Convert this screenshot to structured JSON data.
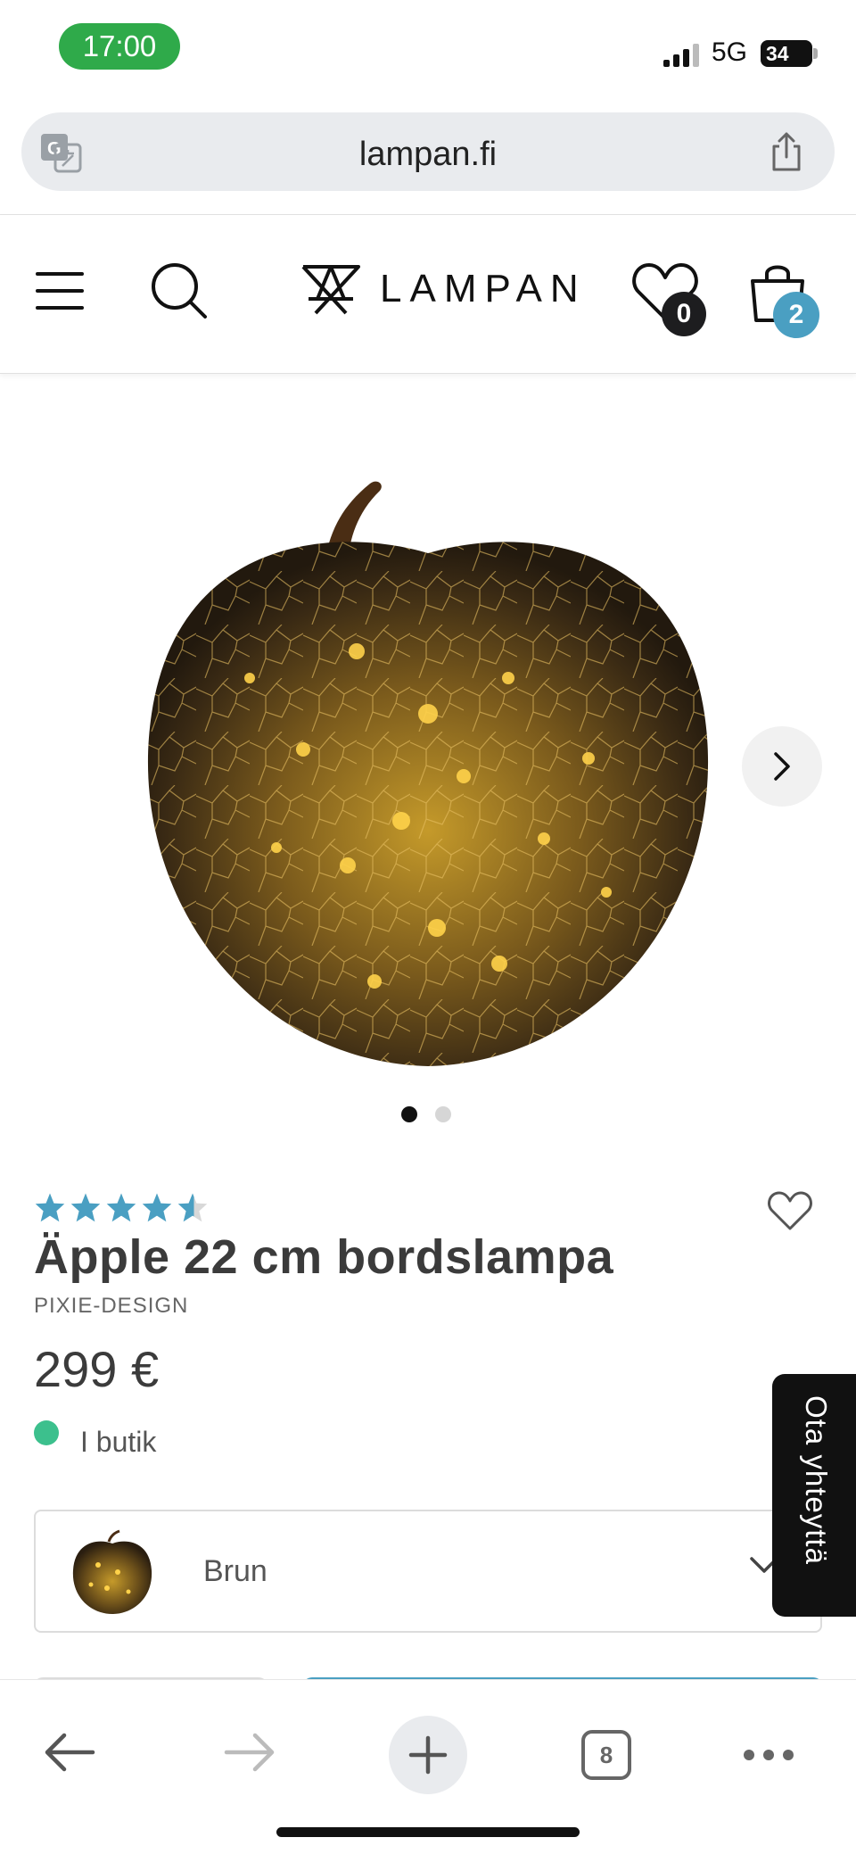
{
  "status_bar": {
    "time": "17:00",
    "network": "5G",
    "battery": "34"
  },
  "browser": {
    "url": "lampan.fi",
    "tab_count": "8"
  },
  "header": {
    "logo_text": "LAMPAN",
    "wishlist_count": "0",
    "cart_count": "2"
  },
  "gallery": {
    "total_images": 2,
    "active_index": 0
  },
  "product": {
    "rating": 4.5,
    "title": "Äpple 22 cm bordslampa",
    "brand": "PIXIE-DESIGN",
    "price": "299 €",
    "stock_status": "I butik"
  },
  "variant": {
    "selected": "Brun"
  },
  "contact_tab": {
    "label": "Ota yhteyttä"
  },
  "colors": {
    "accent": "#4a9fc2",
    "status_green": "#2faa4a",
    "stock_green": "#3cc08d",
    "star_blue": "#4a9fc2",
    "text_dark": "#3b3b3b"
  },
  "icons": {
    "translate": "translate-icon",
    "share": "share-icon",
    "menu": "hamburger-menu-icon",
    "search": "search-icon",
    "wishlist": "heart-icon",
    "cart": "shopping-bag-icon",
    "next": "chevron-right-icon",
    "favorite": "heart-outline-icon",
    "dropdown": "chevron-down-icon",
    "back": "arrow-left-icon",
    "forward": "arrow-right-icon",
    "new_tab": "plus-icon",
    "more": "more-dots-icon"
  }
}
